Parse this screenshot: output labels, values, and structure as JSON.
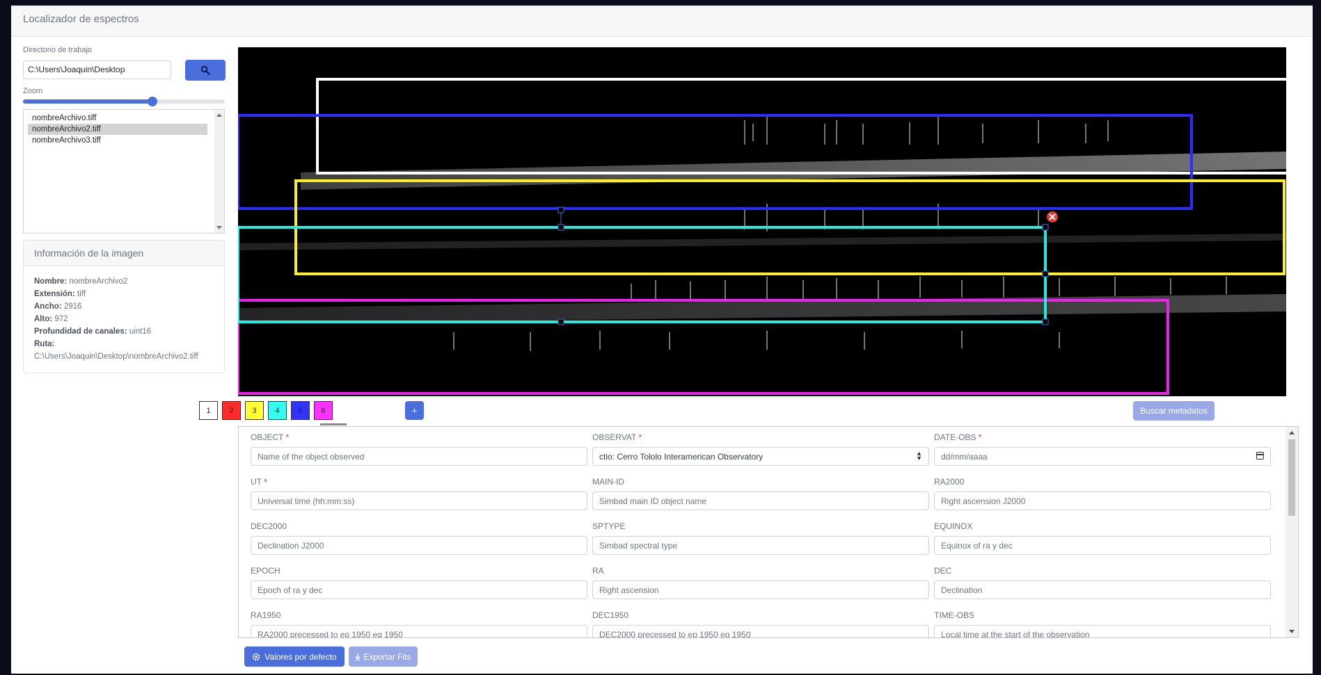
{
  "app": {
    "title": "Localizador de espectros"
  },
  "sidebar": {
    "dir_label": "Directorio de trabajo",
    "dir_value": "C:\\Users\\Joaquin\\Desktop",
    "zoom_label": "Zoom",
    "zoom_value": 0.64,
    "files": [
      "nombreArchivo.tiff",
      "nombreArchivo2.tiff",
      "nombreArchivo3.tiff"
    ],
    "selected_file": "nombreArchivo2.tiff"
  },
  "info": {
    "title": "Información de la imagen",
    "name_label": "Nombre:",
    "name_value": "nombreArchivo2",
    "ext_label": "Extensión:",
    "ext_value": "tiff",
    "width_label": "Ancho:",
    "width_value": "2916",
    "height_label": "Alto:",
    "height_value": "972",
    "depth_label": "Profundidad de canales:",
    "depth_value": "uint16",
    "path_label": "Ruta:",
    "path_value": "C:\\Users\\Joaquin\\Desktop\\nombreArchivo2.tiff"
  },
  "regions": [
    {
      "label": "1",
      "color": "#ffffff"
    },
    {
      "label": "2",
      "color": "#ff2b2b"
    },
    {
      "label": "3",
      "color": "#ffff33"
    },
    {
      "label": "4",
      "color": "#33ffee"
    },
    {
      "label": "5",
      "color": "#3333ff"
    },
    {
      "label": "6",
      "color": "#ff33ff"
    }
  ],
  "selected_region": "4",
  "toolbar": {
    "add_label": "+",
    "metadata_label": "Buscar metadatos"
  },
  "form": {
    "fields": [
      {
        "label": "OBJECT",
        "required": "*",
        "placeholder": "Name of the object observed"
      },
      {
        "label": "OBSERVAT",
        "required": "*",
        "value": "ctio: Cerro Tololo Interamerican Observatory",
        "type": "select"
      },
      {
        "label": "DATE-OBS",
        "required": "*",
        "placeholder": "dd/mm/aaaa",
        "type": "date"
      },
      {
        "label": "UT",
        "required": "*",
        "placeholder": "Universal time (hh:mm:ss)"
      },
      {
        "label": "MAIN-ID",
        "placeholder": "Simbad main ID object name"
      },
      {
        "label": "RA2000",
        "placeholder": "Right ascension J2000"
      },
      {
        "label": "DEC2000",
        "placeholder": "Declination J2000"
      },
      {
        "label": "SPTYPE",
        "placeholder": "Simbad spectral type"
      },
      {
        "label": "EQUINOX",
        "placeholder": "Equinox of ra y dec"
      },
      {
        "label": "EPOCH",
        "placeholder": "Epoch of ra y dec"
      },
      {
        "label": "RA",
        "placeholder": "Right ascension"
      },
      {
        "label": "DEC",
        "placeholder": "Declination"
      },
      {
        "label": "RA1950",
        "placeholder": "RA2000 precessed to ep 1950 eq 1950"
      },
      {
        "label": "DEC1950",
        "placeholder": "DEC2000 precessed to ep 1950 eq 1950"
      },
      {
        "label": "TIME-OBS",
        "placeholder": "Local time at the start of the observation"
      }
    ]
  },
  "actions": {
    "defaults_label": "Valores por defecto",
    "export_label": "Exportar Fits"
  },
  "icons": {
    "search": "magnifier-icon",
    "gear": "gear-icon",
    "download": "download-icon",
    "close": "close-circle-icon"
  }
}
